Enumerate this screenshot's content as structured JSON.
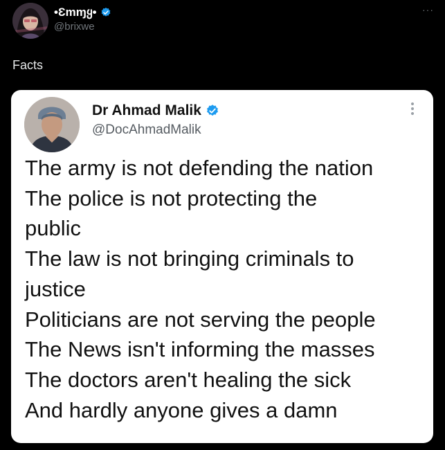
{
  "author": {
    "display_name": "•Ɛmɱყ•",
    "handle": "@brixwe",
    "verified": true,
    "avatar_icon": "avatar-icon"
  },
  "more_icon": "more-horizontal-icon",
  "tweet": {
    "text": "Facts"
  },
  "quoted_image": {
    "author": {
      "display_name": "Dr Ahmad Malik",
      "handle": "@DocAhmadMalik",
      "verified": true
    },
    "more_icon": "more-vertical-icon",
    "lines": [
      "The army is not defending the nation",
      "The police is not protecting the",
      "public",
      "The law is not bringing criminals to",
      "justice",
      "Politicians are not serving the people",
      "The News isn't informing the masses",
      "The doctors aren't healing the sick",
      "And hardly anyone gives a damn"
    ]
  },
  "colors": {
    "background": "#000000",
    "verified": "#1d9bf0",
    "text_primary": "#e7e9ea",
    "text_secondary": "#71767b"
  }
}
